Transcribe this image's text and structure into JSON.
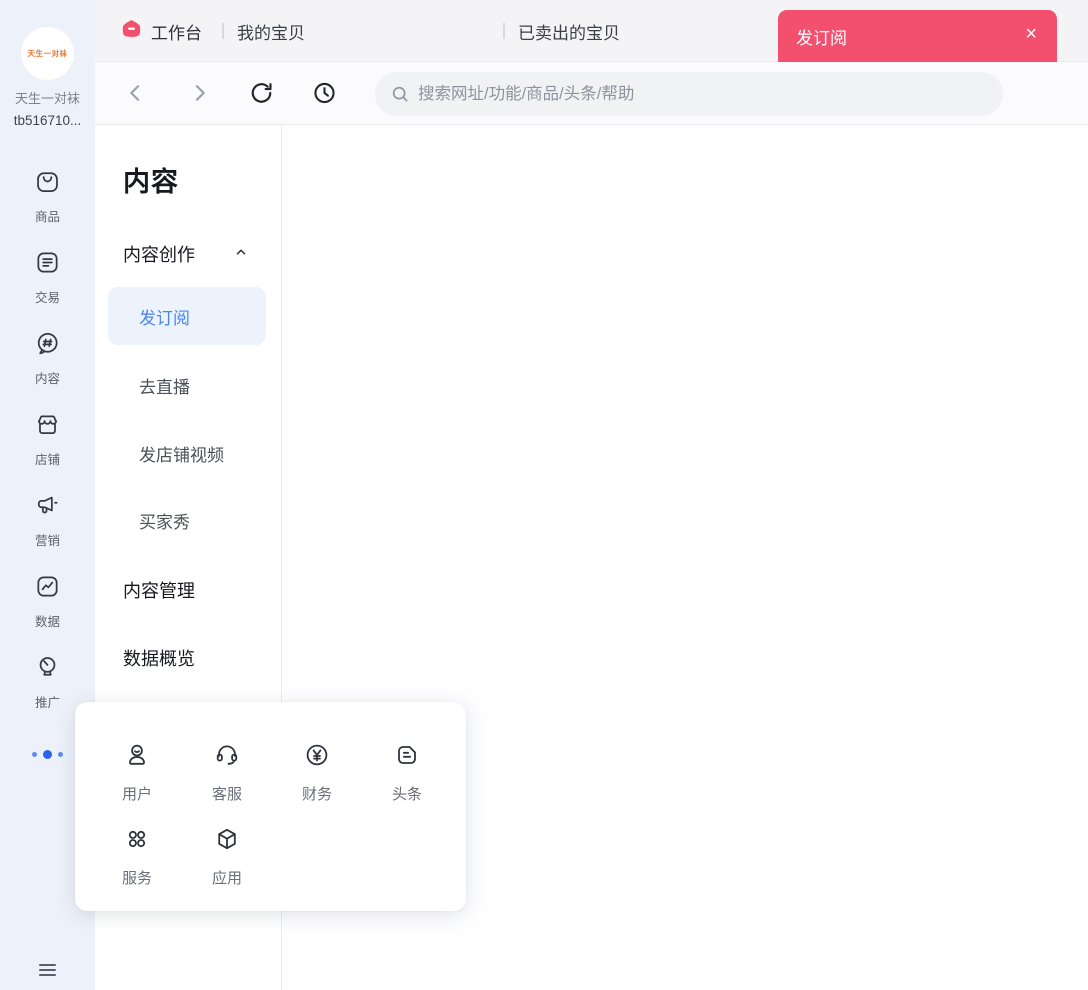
{
  "colors": {
    "accent_pink": "#f2506e",
    "accent_blue": "#4b84f2",
    "selected_item_bg": "#ecf3fd",
    "sidebar_bg": "#edf1fa"
  },
  "sidebar": {
    "avatar_text": "天生一对袜",
    "shop_name": "天生一对袜",
    "shop_id": "tb516710...",
    "items": [
      {
        "label": "商品",
        "icon": "goods-bag-icon"
      },
      {
        "label": "交易",
        "icon": "trade-order-icon"
      },
      {
        "label": "内容",
        "icon": "content-hash-bubble-icon"
      },
      {
        "label": "店铺",
        "icon": "storefront-icon"
      },
      {
        "label": "营销",
        "icon": "megaphone-icon"
      },
      {
        "label": "数据",
        "icon": "line-chart-icon"
      },
      {
        "label": "推广",
        "icon": "lightbulb-icon"
      }
    ]
  },
  "tabbar": {
    "workbench_label": "工作台",
    "tabs": [
      {
        "label": "我的宝贝"
      },
      {
        "label": "已卖出的宝贝"
      }
    ],
    "active_tab": {
      "label": "发订阅",
      "close_glyph": "×"
    }
  },
  "navbar": {
    "search_placeholder": "搜索网址/功能/商品/头条/帮助"
  },
  "menu": {
    "title": "内容",
    "groups": {
      "create": "内容创作",
      "manage": "内容管理",
      "overview": "数据概览"
    },
    "items": {
      "subscribe": "发订阅",
      "live": "去直播",
      "shop_video": "发店铺视频",
      "buyer_show": "买家秀"
    }
  },
  "popup": {
    "items": [
      {
        "label": "用户",
        "icon": "user-icon"
      },
      {
        "label": "客服",
        "icon": "headset-icon"
      },
      {
        "label": "财务",
        "icon": "yuan-circle-icon"
      },
      {
        "label": "头条",
        "icon": "news-card-icon"
      },
      {
        "label": "服务",
        "icon": "services-dots-icon"
      },
      {
        "label": "应用",
        "icon": "apps-cube-icon"
      }
    ]
  }
}
